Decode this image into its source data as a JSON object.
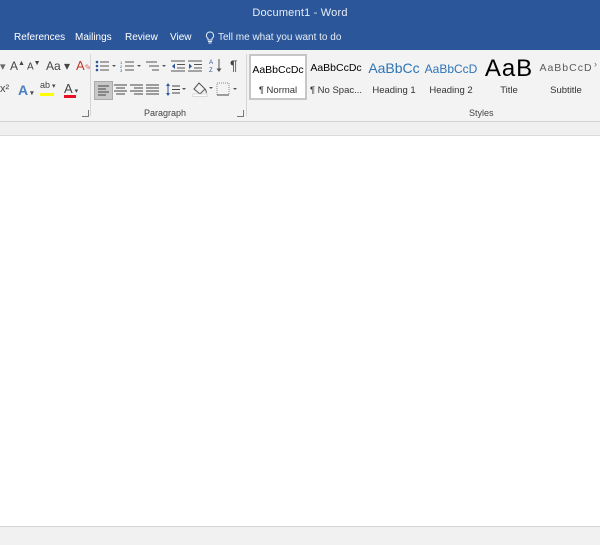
{
  "window": {
    "title": "Document1  -  Word"
  },
  "menu": {
    "tabs": [
      {
        "label": "References"
      },
      {
        "label": "Mailings"
      },
      {
        "label": "Review"
      },
      {
        "label": "View"
      }
    ],
    "tell_me": "Tell me what you want to do"
  },
  "ribbon": {
    "font": {
      "grow_font": "A",
      "shrink_font": "A",
      "change_case": "Aa",
      "superscript": "x²",
      "text_effects": "A",
      "highlight": "ab",
      "font_color": "A"
    },
    "paragraph": {
      "label": "Paragraph",
      "show_marks": "¶"
    },
    "styles": {
      "label": "Styles",
      "items": [
        {
          "preview": "AaBbCcDc",
          "label": "¶ Normal"
        },
        {
          "preview": "AaBbCcDc",
          "label": "¶ No Spac..."
        },
        {
          "preview": "AaBbCc",
          "label": "Heading 1"
        },
        {
          "preview": "AaBbCcD",
          "label": "Heading 2"
        },
        {
          "preview": "AaB",
          "label": "Title"
        },
        {
          "preview": "AaBbCcD",
          "label": "Subtitle"
        }
      ]
    }
  },
  "colors": {
    "accent": "#2b579a",
    "highlight": "#ffff00",
    "font_color": "#e81123"
  }
}
